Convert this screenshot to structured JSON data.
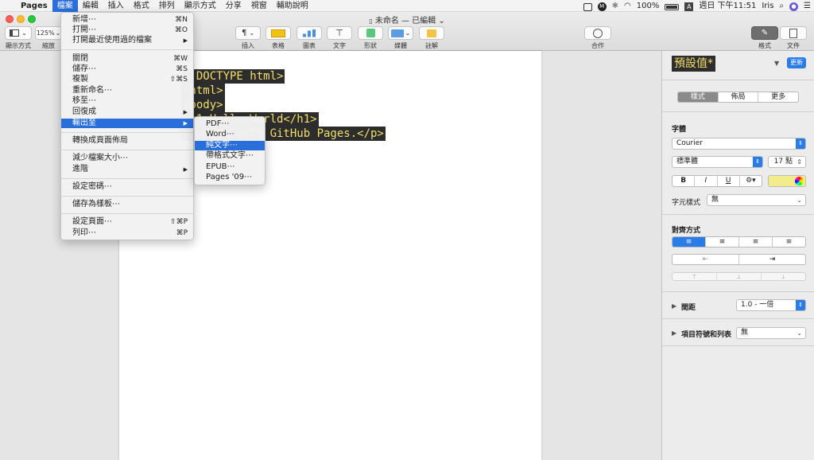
{
  "menubar": {
    "apple": "",
    "app": "Pages",
    "items": [
      "檔案",
      "編輯",
      "插入",
      "格式",
      "排列",
      "顯示方式",
      "分享",
      "視窗",
      "輔助說明"
    ],
    "status": {
      "battery": "100%",
      "clock": "週日 下午11:51",
      "user": "Iris",
      "input_badge": "A",
      "m_badge": "M"
    }
  },
  "window": {
    "title": "未命名 — 已編輯",
    "title_chevron": "⌄"
  },
  "toolbar": {
    "view_label": "顯示方式",
    "zoom_value": "125%",
    "zoom_label": "縮放",
    "insert_label": "插入",
    "table_label": "表格",
    "chart_label": "圖表",
    "text_label": "文字",
    "shape_label": "形狀",
    "media_label": "媒體",
    "comment_label": "註解",
    "collab_label": "合作",
    "format_label": "格式",
    "document_label": "文件"
  },
  "document": {
    "lines": [
      "<!DOCTYPE html>",
      "<html>",
      "<body>",
      "<h1>Hello World</h1>",
      "<p>Made with GitHub Pages.</p>"
    ]
  },
  "file_menu": {
    "items": [
      {
        "label": "新增⋯",
        "shortcut": "⌘N"
      },
      {
        "label": "打開⋯",
        "shortcut": "⌘O"
      },
      {
        "label": "打開最近使用過的檔案",
        "shortcut": "▶"
      },
      {
        "label": "關閉",
        "shortcut": "⌘W"
      },
      {
        "label": "儲存⋯",
        "shortcut": "⌘S"
      },
      {
        "label": "複製",
        "shortcut": "⇧⌘S"
      },
      {
        "label": "重新命名⋯",
        "shortcut": ""
      },
      {
        "label": "移至⋯",
        "shortcut": ""
      },
      {
        "label": "回復成",
        "shortcut": "▶"
      },
      {
        "label": "輸出至",
        "shortcut": "▶"
      },
      {
        "label": "轉換成頁面佈局",
        "shortcut": ""
      },
      {
        "label": "減少檔案大小⋯",
        "shortcut": ""
      },
      {
        "label": "進階",
        "shortcut": "▶"
      },
      {
        "label": "設定密碼⋯",
        "shortcut": ""
      },
      {
        "label": "儲存為樣板⋯",
        "shortcut": ""
      },
      {
        "label": "設定頁面⋯",
        "shortcut": "⇧⌘P"
      },
      {
        "label": "列印⋯",
        "shortcut": "⌘P"
      }
    ]
  },
  "export_submenu": {
    "items": [
      "PDF⋯",
      "Word⋯",
      "純文字⋯",
      "帶格式文字⋯",
      "EPUB⋯",
      "Pages '09⋯"
    ]
  },
  "sidebar": {
    "style_name": "預設值*",
    "update_label": "更新",
    "tabs": [
      "樣式",
      "佈局",
      "更多"
    ],
    "font_section": "字體",
    "font_family": "Courier",
    "font_style": "標準體",
    "font_size": "17 點",
    "bold": "B",
    "italic": "I",
    "underline": "U",
    "gear": "⚙▾",
    "char_style_label": "字元樣式",
    "char_style_value": "無",
    "align_section": "對齊方式",
    "align_icons": [
      "≡",
      "≡",
      "≡",
      "≡"
    ],
    "indent_icons": [
      "⇤",
      "⇥"
    ],
    "vert_icons": [
      "⊤",
      "⊥",
      "⊥"
    ],
    "spacing_label": "間距",
    "spacing_value": "1.0 - 一倍",
    "list_label": "項目符號和列表",
    "list_value": "無"
  },
  "colors": {
    "menu_highlight": "#2a6edb",
    "code_bg": "#2d2d2d",
    "code_fg": "#f3df6a",
    "accent": "#2a7ce8"
  }
}
